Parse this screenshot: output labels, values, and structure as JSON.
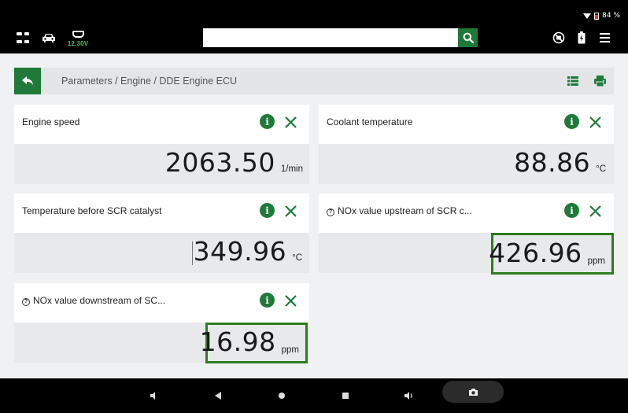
{
  "status": {
    "battery_percent": "84 %"
  },
  "toolbar": {
    "voltage": "12.30V",
    "search": {
      "value": "",
      "placeholder": ""
    }
  },
  "breadcrumb": "Parameters / Engine / DDE Engine ECU",
  "cards": [
    {
      "title": "Engine speed",
      "value": "2063.50",
      "unit": "1/min",
      "has_help": false,
      "highlighted": false
    },
    {
      "title": "Coolant temperature",
      "value": "88.86",
      "unit": "°C",
      "has_help": false,
      "highlighted": false
    },
    {
      "title": "Temperature before SCR catalyst",
      "value": "349.96",
      "unit": "°C",
      "has_help": false,
      "highlighted": false
    },
    {
      "title": "NOx value upstream of SCR c...",
      "value": "426.96",
      "unit": "ppm",
      "has_help": true,
      "highlighted": true
    },
    {
      "title": "NOx value downstream of SC...",
      "value": "16.98",
      "unit": "ppm",
      "has_help": true,
      "highlighted": true
    }
  ],
  "icons": {
    "help_glyph": "?",
    "info_glyph": "i"
  },
  "colors": {
    "accent_green": "#1f7a3a",
    "highlight_green": "#2e7d1e",
    "voltage_green": "#4cc35a"
  }
}
